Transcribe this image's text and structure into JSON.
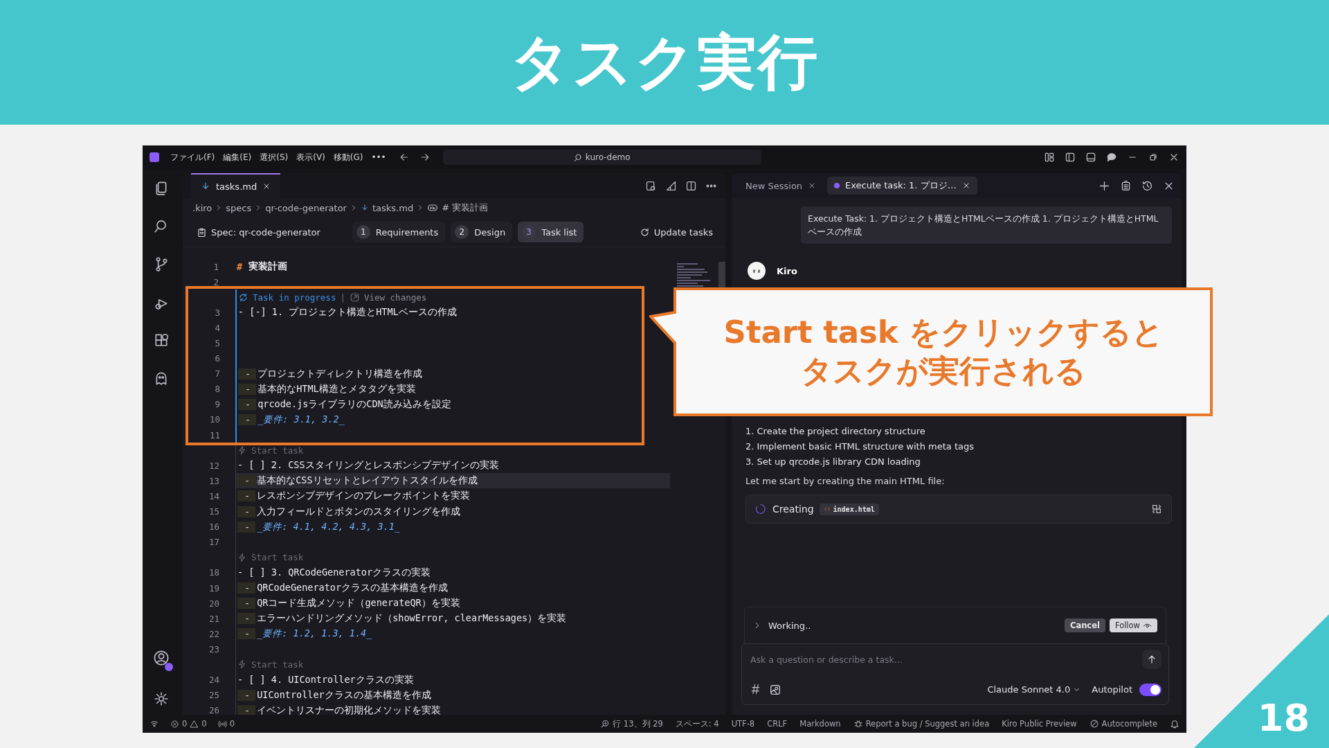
{
  "slide": {
    "title": "タスク実行",
    "page_number": "18"
  },
  "titlebar": {
    "menu": [
      "ファイル(F)",
      "編集(E)",
      "選択(S)",
      "表示(V)",
      "移動(G)",
      "•••"
    ],
    "search": "kuro-demo"
  },
  "editor": {
    "tab": {
      "label": "tasks.md",
      "selected": true
    },
    "breadcrumb": [
      {
        "kind": "folder",
        "label": ".kiro"
      },
      {
        "kind": "folder",
        "label": "specs"
      },
      {
        "kind": "folder",
        "label": "qr-code-generator"
      },
      {
        "kind": "file",
        "label": "tasks.md"
      },
      {
        "kind": "symbol",
        "label": "# 実装計画"
      }
    ],
    "spec": {
      "label": "Spec: qr-code-generator",
      "steps": [
        {
          "num": "1",
          "label": "Requirements",
          "selected": false
        },
        {
          "num": "2",
          "label": "Design",
          "selected": false
        },
        {
          "num": "3",
          "label": "Task list",
          "selected": true
        }
      ],
      "update": "Update tasks"
    },
    "lines": [
      {
        "num": "1",
        "kind": "heading",
        "mark": "#",
        "text": "実装計画",
        "current": false
      },
      {
        "num": "2",
        "kind": "blank",
        "current": false
      }
    ],
    "tasks": [
      {
        "in_progress": true,
        "lens": {
          "label": "Task in progress",
          "separator": "|",
          "action": "View changes"
        },
        "lines": [
          {
            "num": "3",
            "kind": "task",
            "text": "- [-] 1. プロジェクト構造とHTMLベースの作成",
            "current": false
          },
          {
            "num": "4",
            "kind": "blank",
            "current": false
          },
          {
            "num": "5",
            "kind": "blank",
            "current": false
          },
          {
            "num": "6",
            "kind": "blank",
            "current": false
          },
          {
            "num": "7",
            "kind": "sub",
            "bullet": "-",
            "text": "プロジェクトディレクトリ構造を作成",
            "current": false
          },
          {
            "num": "8",
            "kind": "sub",
            "bullet": "-",
            "text": "基本的なHTML構造とメタタグを実装",
            "current": false
          },
          {
            "num": "9",
            "kind": "sub",
            "bullet": "-",
            "text": "qrcode.jsライブラリのCDN読み込みを設定",
            "current": false
          },
          {
            "num": "10",
            "kind": "req",
            "bullet": "-",
            "text": "_要件: 3.1, 3.2_",
            "current": false
          },
          {
            "num": "11",
            "kind": "blank",
            "current": false
          }
        ]
      },
      {
        "in_progress": false,
        "lens": {
          "label": "Start task"
        },
        "lines": [
          {
            "num": "12",
            "kind": "task",
            "text": "- [ ] 2. CSSスタイリングとレスポンシブデザインの実装",
            "current": false
          },
          {
            "num": "13",
            "kind": "sub",
            "bullet": "-",
            "text": "基本的なCSSリセットとレイアウトスタイルを作成",
            "current": true
          },
          {
            "num": "14",
            "kind": "sub",
            "bullet": "-",
            "text": "レスポンシブデザインのブレークポイントを実装",
            "current": false
          },
          {
            "num": "15",
            "kind": "sub",
            "bullet": "-",
            "text": "入力フィールドとボタンのスタイリングを作成",
            "current": false
          },
          {
            "num": "16",
            "kind": "req",
            "bullet": "-",
            "text": "_要件: 4.1, 4.2, 4.3, 3.1_",
            "current": false
          },
          {
            "num": "17",
            "kind": "blank",
            "current": false
          }
        ]
      },
      {
        "in_progress": false,
        "lens": {
          "label": "Start task"
        },
        "lines": [
          {
            "num": "18",
            "kind": "task",
            "text": "- [ ] 3. QRCodeGeneratorクラスの実装",
            "current": false
          },
          {
            "num": "19",
            "kind": "sub",
            "bullet": "-",
            "text": "QRCodeGeneratorクラスの基本構造を作成",
            "current": false
          },
          {
            "num": "20",
            "kind": "sub",
            "bullet": "-",
            "text": "QRコード生成メソッド（generateQR）を実装",
            "current": false
          },
          {
            "num": "21",
            "kind": "sub",
            "bullet": "-",
            "text": "エラーハンドリングメソッド（showError, clearMessages）を実装",
            "current": false
          },
          {
            "num": "22",
            "kind": "req",
            "bullet": "-",
            "text": "_要件: 1.2, 1.3, 1.4_",
            "current": false
          },
          {
            "num": "23",
            "kind": "blank",
            "current": false
          }
        ]
      },
      {
        "in_progress": false,
        "lens": {
          "label": "Start task"
        },
        "lines": [
          {
            "num": "24",
            "kind": "task",
            "text": "- [ ] 4. UIControllerクラスの実装",
            "current": false
          },
          {
            "num": "25",
            "kind": "sub",
            "bullet": "-",
            "text": "UIControllerクラスの基本構造を作成",
            "current": false
          },
          {
            "num": "26",
            "kind": "sub",
            "bullet": "-",
            "text": "イベントリスナーの初期化メソッドを実装",
            "current": false
          }
        ]
      }
    ]
  },
  "chat": {
    "tabs": [
      {
        "label": "New Session",
        "selected": false
      },
      {
        "label": "Execute task: 1. プロジ…",
        "selected": true
      }
    ],
    "user_message": "Execute Task: 1. プロジェクト構造とHTMLベースの作成 1. プロジェクト構造とHTMLベースの作成",
    "agent": {
      "name": "Kiro"
    },
    "steps": [
      "1. Create the project directory structure",
      "2. Implement basic HTML structure with meta tags",
      "3. Set up qrcode.js library CDN loading"
    ],
    "note": "Let me start by creating the main HTML file:",
    "action": {
      "label": "Creating",
      "file": "index.html"
    },
    "status": {
      "label": "Working..",
      "cancel": "Cancel",
      "follow": "Follow"
    },
    "composer": {
      "placeholder": "Ask a question or describe a task...",
      "context_symbol": "#",
      "model": "Claude Sonnet 4.0",
      "autopilot": {
        "label": "Autopilot",
        "on": true
      }
    }
  },
  "status_bar": {
    "errors": "0",
    "warnings": "0",
    "ports": "0",
    "items": [
      {
        "kind": "position",
        "label": "行 13、列 29"
      },
      {
        "kind": "indent",
        "label": "スペース: 4"
      },
      {
        "kind": "encoding",
        "label": "UTF-8"
      },
      {
        "kind": "eol",
        "label": "CRLF"
      },
      {
        "kind": "language",
        "label": "Markdown"
      },
      {
        "kind": "feedback",
        "label": "Report a bug / Suggest an idea"
      },
      {
        "kind": "channel",
        "label": "Kiro Public Preview"
      },
      {
        "kind": "autocomplete",
        "label": "Autocomplete"
      }
    ]
  },
  "callout": {
    "lines": [
      "Start task をクリックすると",
      "タスクが実行される"
    ]
  }
}
